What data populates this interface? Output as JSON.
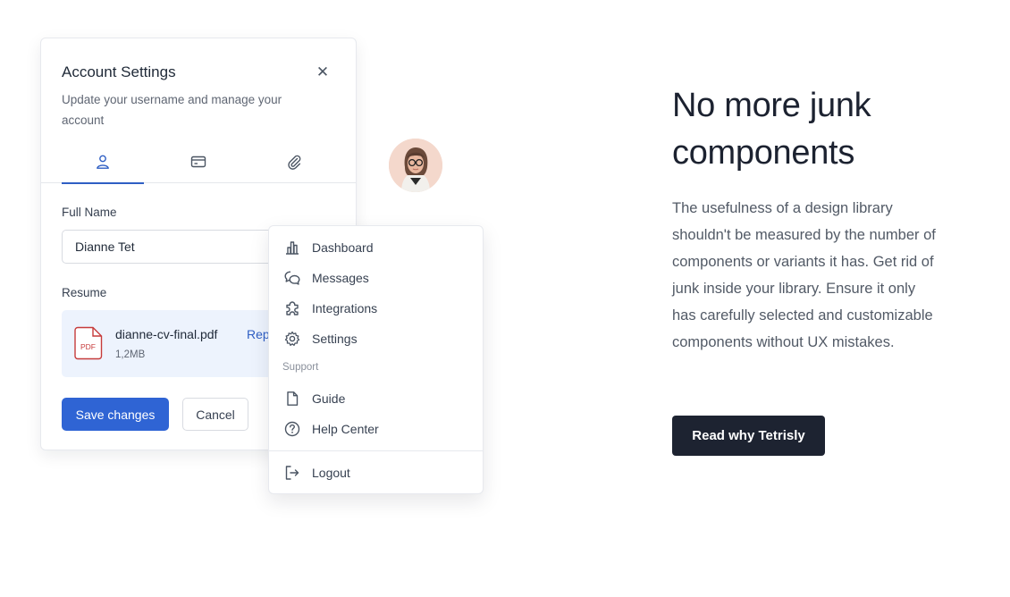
{
  "account_settings": {
    "title": "Account Settings",
    "subtitle": "Update your username and manage your account",
    "close_icon": "close-icon",
    "tabs": [
      {
        "icon": "user-icon",
        "active": true
      },
      {
        "icon": "credit-card-icon",
        "active": false
      },
      {
        "icon": "paperclip-icon",
        "active": false
      }
    ],
    "full_name_label": "Full Name",
    "full_name_value": "Dianne Tet",
    "resume_label": "Resume",
    "resume_file": {
      "badge": "PDF",
      "name": "dianne-cv-final.pdf",
      "size": "1,2MB",
      "replace_label": "Rep"
    },
    "save_label": "Save changes",
    "cancel_label": "Cancel",
    "accent_color": "#2f64d4"
  },
  "avatar": {
    "icon": "avatar-photo"
  },
  "menu": {
    "items": [
      {
        "icon": "bar-chart-icon",
        "label": "Dashboard"
      },
      {
        "icon": "chat-bubbles-icon",
        "label": "Messages"
      },
      {
        "icon": "puzzle-icon",
        "label": "Integrations"
      },
      {
        "icon": "gear-icon",
        "label": "Settings"
      }
    ],
    "section_label": "Support",
    "support_items": [
      {
        "icon": "document-icon",
        "label": "Guide"
      },
      {
        "icon": "help-circle-icon",
        "label": "Help Center"
      }
    ],
    "logout": {
      "icon": "logout-icon",
      "label": "Logout"
    }
  },
  "hero": {
    "title": "No more junk components",
    "body": "The usefulness of a design library shouldn't be measured by the number of components or variants it has. Get rid of junk inside your library. Ensure it only has carefully selected and customizable components without UX mistakes.",
    "cta_label": "Read why Tetrisly",
    "cta_color": "#1d2331"
  }
}
